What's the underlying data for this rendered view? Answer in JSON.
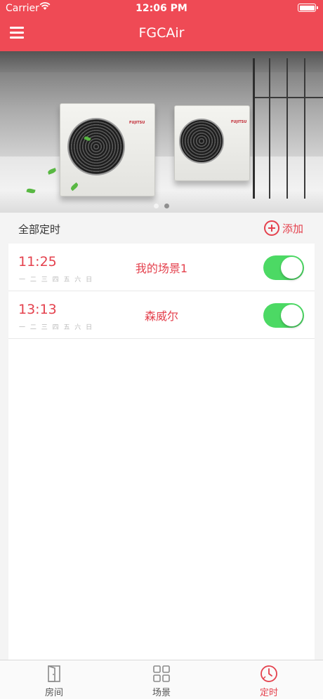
{
  "status_bar": {
    "carrier": "Carrier",
    "time": "12:06 PM"
  },
  "nav": {
    "title": "FGCAir",
    "menu_icon": "hamburger-menu-icon"
  },
  "banner": {
    "brand": "FUJITSU",
    "page_count": 2,
    "active_page": 2
  },
  "section": {
    "title": "全部定时",
    "add_label": "添加",
    "add_icon": "plus-circle-icon"
  },
  "timers": [
    {
      "time": "11:25",
      "days": "一 二 三 四 五 六 日",
      "scene": "我的场景1",
      "enabled": true
    },
    {
      "time": "13:13",
      "days": "一 二 三 四 五 六 日",
      "scene": "森威尔",
      "enabled": true
    }
  ],
  "tabs": [
    {
      "label": "房间",
      "icon": "door-icon",
      "active": false
    },
    {
      "label": "场景",
      "icon": "grid-icon",
      "active": false
    },
    {
      "label": "定时",
      "icon": "clock-icon",
      "active": true
    }
  ],
  "colors": {
    "accent": "#ef4a55",
    "accent_text": "#e4414d",
    "switch_on": "#4cd964"
  }
}
